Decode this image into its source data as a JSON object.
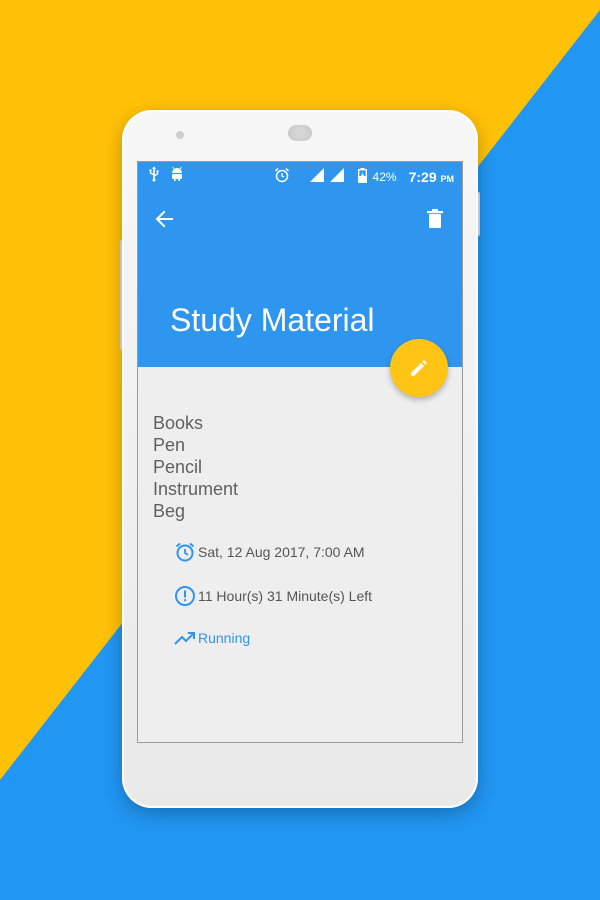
{
  "colors": {
    "background_yellow": "#FFC107",
    "background_blue": "#2196F3",
    "app_bar": "#2F96EF",
    "fab": "#FFC414",
    "accent_text": "#2F96EF"
  },
  "status_bar": {
    "icons_left": [
      "usb-icon",
      "android-debug-icon"
    ],
    "icons_right": [
      "alarm-icon",
      "signal-icon",
      "signal-icon",
      "battery-charging-icon"
    ],
    "battery": "42%",
    "time": "7:29",
    "ampm": "PM"
  },
  "app_bar": {
    "back_icon": "arrow-back-icon",
    "delete_icon": "trash-icon",
    "title": "Study Material"
  },
  "fab": {
    "icon": "pencil-icon"
  },
  "note": {
    "items": [
      "Books",
      "Pen",
      "Pencil",
      "Instrument",
      "Beg"
    ]
  },
  "reminder": {
    "datetime": "Sat, 12 Aug 2017, 7:00 AM",
    "time_left": "11 Hour(s) 31 Minute(s)  Left",
    "status": "Running"
  }
}
